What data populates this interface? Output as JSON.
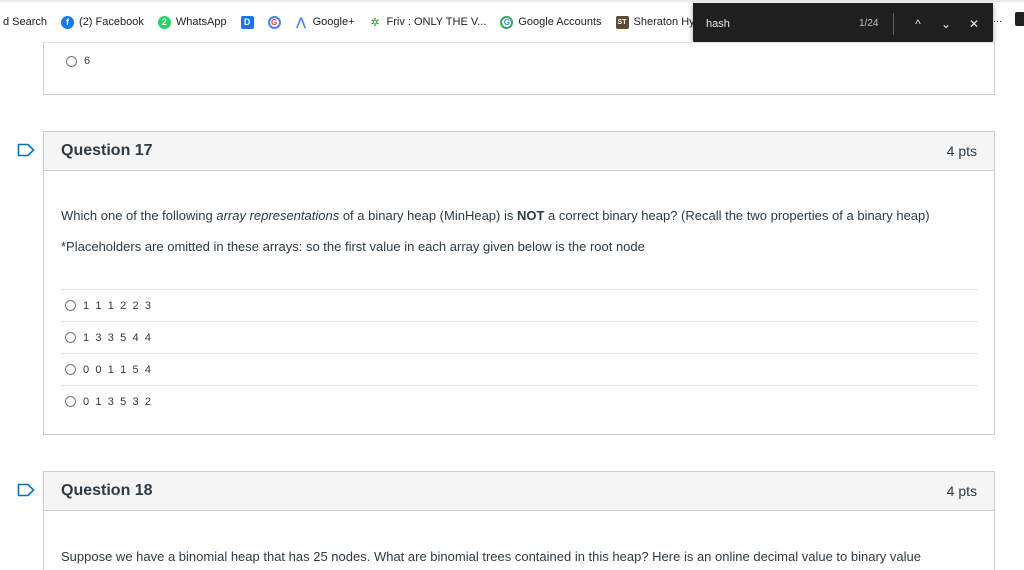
{
  "browser": {
    "bookmarks": [
      {
        "label": "d Search",
        "icon": "none"
      },
      {
        "label": "(2) Facebook",
        "icon": "facebook-icon",
        "glyph": "f"
      },
      {
        "label": "WhatsApp",
        "icon": "whatsapp-icon",
        "glyph": "2"
      },
      {
        "label": "",
        "icon": "d-app-icon",
        "glyph": "D"
      },
      {
        "label": "",
        "icon": "google-icon",
        "glyph": "G"
      },
      {
        "label": "Google+",
        "icon": "google-plus-icon",
        "glyph": "⋀"
      },
      {
        "label": "Friv : ONLY THE V...",
        "icon": "friv-icon",
        "glyph": "✲"
      },
      {
        "label": "Google Accounts",
        "icon": "google-accounts-icon",
        "glyph": "G"
      },
      {
        "label": "Sheraton Hy",
        "icon": "sheraton-icon",
        "glyph": "ST"
      }
    ],
    "find": {
      "query": "hash",
      "count": "1/24",
      "prev": "^",
      "next": "⌄",
      "close": "✕"
    },
    "more_label": "..."
  },
  "prev_question": {
    "last_answer": "6"
  },
  "questions": [
    {
      "title": "Question 17",
      "points": "4 pts",
      "text_before": "Which one of the following ",
      "text_em": "array representations",
      "text_mid": " of a binary heap (MinHeap) is ",
      "text_strong": "NOT",
      "text_after": " a correct binary heap? (Recall the two properties of a binary heap)",
      "note": "*Placeholders are omitted in these arrays: so the first value in each array given below is the root node",
      "answers": [
        "1 1 1 2 2 3",
        "1 3 3 5 4 4",
        "0 0 1 1 5 4",
        "0 1 3 5 3 2"
      ]
    },
    {
      "title": "Question 18",
      "points": "4 pts",
      "text": "Suppose we have a binomial heap that has 25 nodes. What are binomial trees contained in this heap? Here is an online decimal value to binary value"
    }
  ],
  "colors": {
    "accent": "#0374b5",
    "border": "#c7cdd1",
    "header_bg": "#f5f5f5",
    "text": "#2d3b45"
  }
}
